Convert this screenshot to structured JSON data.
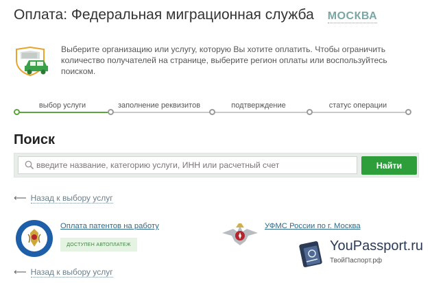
{
  "header": {
    "title": "Оплата: Федеральная миграционная служба",
    "region": "МОСКВА"
  },
  "info": {
    "text": "Выберите организацию или услугу, которую Вы хотите оплатить. Чтобы ограничить количество получателей на странице, выберите регион оплаты или воспользуйтесь поиском."
  },
  "steps": [
    {
      "label": "выбор услуги",
      "active": true
    },
    {
      "label": "заполнение реквизитов",
      "active": false
    },
    {
      "label": "подтверждение",
      "active": false
    },
    {
      "label": "статус операции",
      "active": false
    }
  ],
  "search": {
    "heading": "Поиск",
    "placeholder": "введите название, категорию услуги, ИНН или расчетный счет",
    "button_label": "Найти"
  },
  "back_link": {
    "label": "Назад к выбору услуг"
  },
  "services": [
    {
      "name": "Оплата патентов на работу",
      "badge": "доступен автоплатеж"
    },
    {
      "name": "УФМС России по г. Москва"
    }
  ],
  "watermark": {
    "title": "YouPassport.ru",
    "subtitle": "ТвойПаспорт.рф"
  },
  "colors": {
    "accent_green": "#2e9e3b",
    "progress_green": "#5aa63a",
    "region_link": "#7aa7a4",
    "link_blue": "#2d6a8a"
  }
}
